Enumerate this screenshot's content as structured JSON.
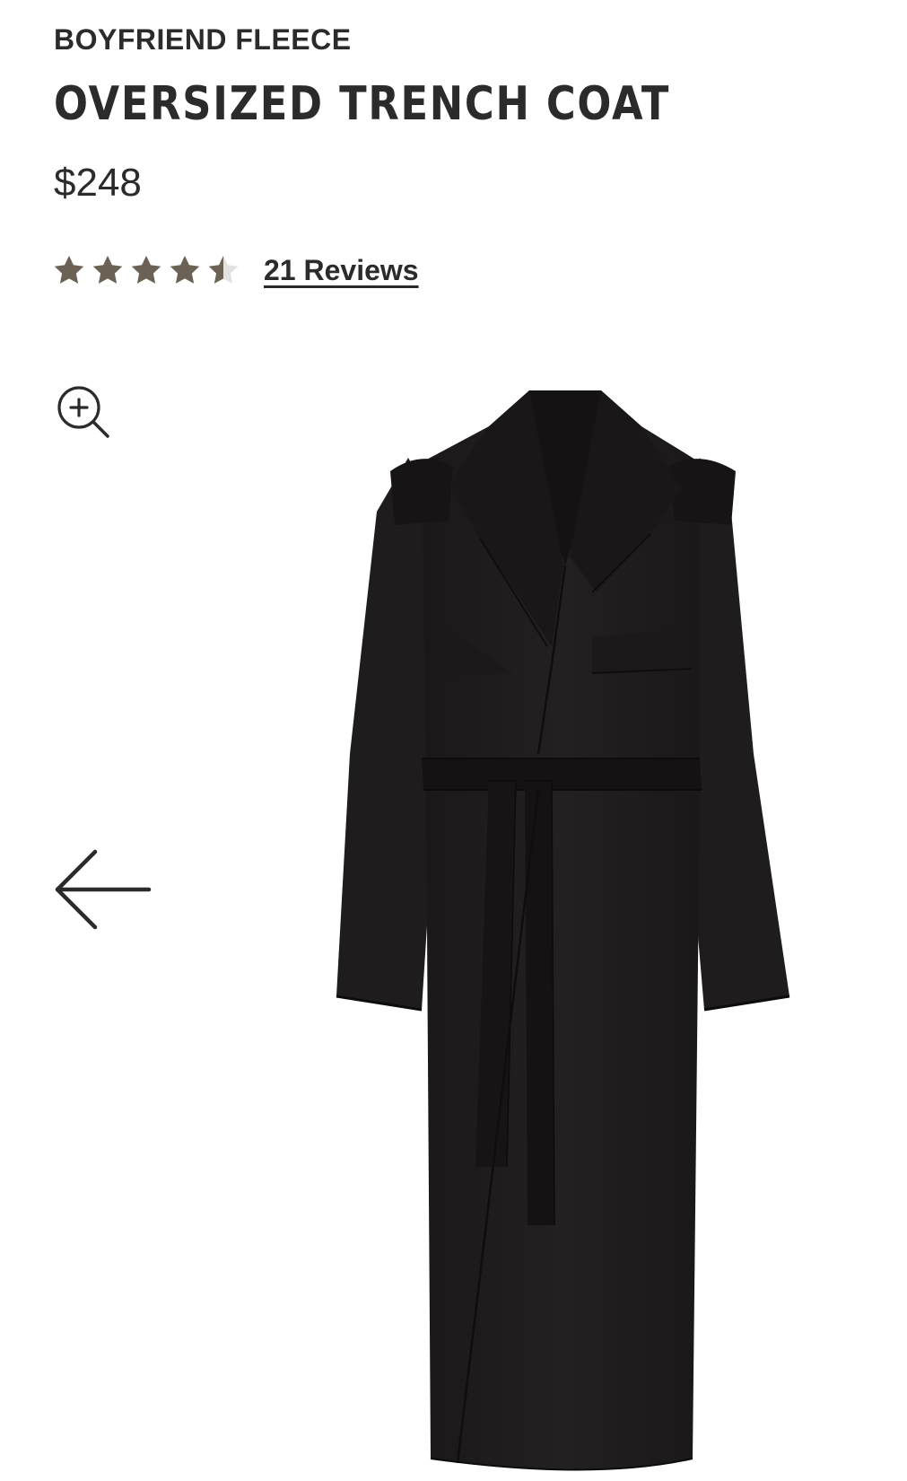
{
  "product": {
    "brand": "BOYFRIEND FLEECE",
    "title": "OVERSIZED TRENCH COAT",
    "price": "$248"
  },
  "rating": {
    "value": 4.5,
    "max": 5,
    "reviews_label": "21 Reviews",
    "star_color": "#6b6154",
    "star_empty_color": "#e2e2e2"
  },
  "gallery": {
    "zoom_icon": "zoom-in-icon",
    "back_icon": "arrow-left-icon",
    "image_subject": "black trench coat"
  }
}
